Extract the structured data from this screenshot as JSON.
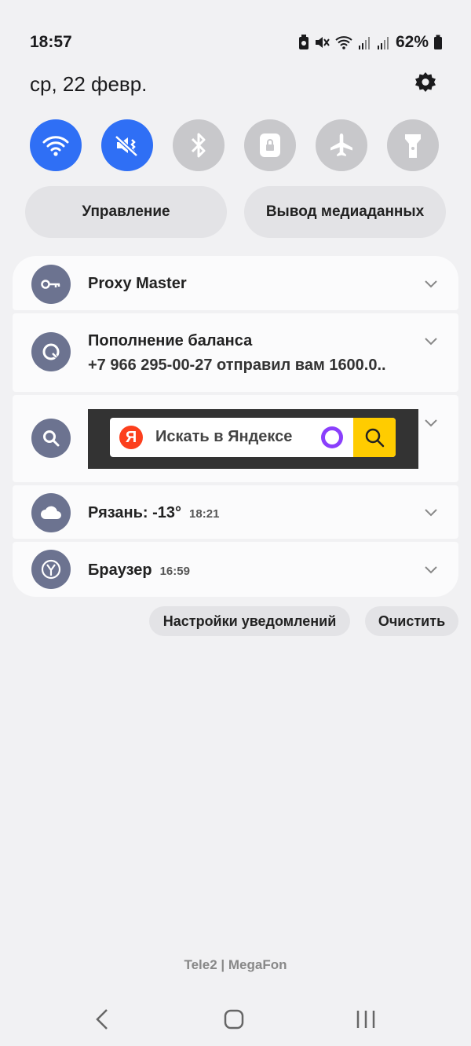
{
  "status_bar": {
    "time": "18:57",
    "battery": "62%"
  },
  "header": {
    "date": "ср, 22 февр."
  },
  "quick_settings": [
    {
      "name": "wifi",
      "state": "on"
    },
    {
      "name": "mute",
      "state": "on"
    },
    {
      "name": "bluetooth",
      "state": "off"
    },
    {
      "name": "screen-lock",
      "state": "off"
    },
    {
      "name": "airplane",
      "state": "off"
    },
    {
      "name": "flashlight",
      "state": "off"
    }
  ],
  "pills": {
    "control": "Управление",
    "media_output": "Вывод медиаданных"
  },
  "notifications": [
    {
      "app": "proxy",
      "title": "Proxy Master"
    },
    {
      "app": "bank",
      "title": "Пополнение баланса",
      "text": "+7 966 295-00-27 отправил вам 1600.0.."
    },
    {
      "app": "yandex-search",
      "widget_text": "Искать в Яндексе",
      "logo_letter": "Я"
    },
    {
      "app": "weather",
      "title": "Рязань: -13°",
      "time": "18:21"
    },
    {
      "app": "browser",
      "title": "Браузер",
      "time": "16:59"
    }
  ],
  "actions": {
    "notif_settings": "Настройки уведомлений",
    "clear": "Очистить"
  },
  "footer": {
    "carrier": "Tele2 | MegaFon"
  },
  "colors": {
    "accent": "#2f6ff5",
    "yandex_red": "#fc3f1d",
    "yandex_yellow": "#ffcc00",
    "alice_purple": "#8a3ffc"
  }
}
